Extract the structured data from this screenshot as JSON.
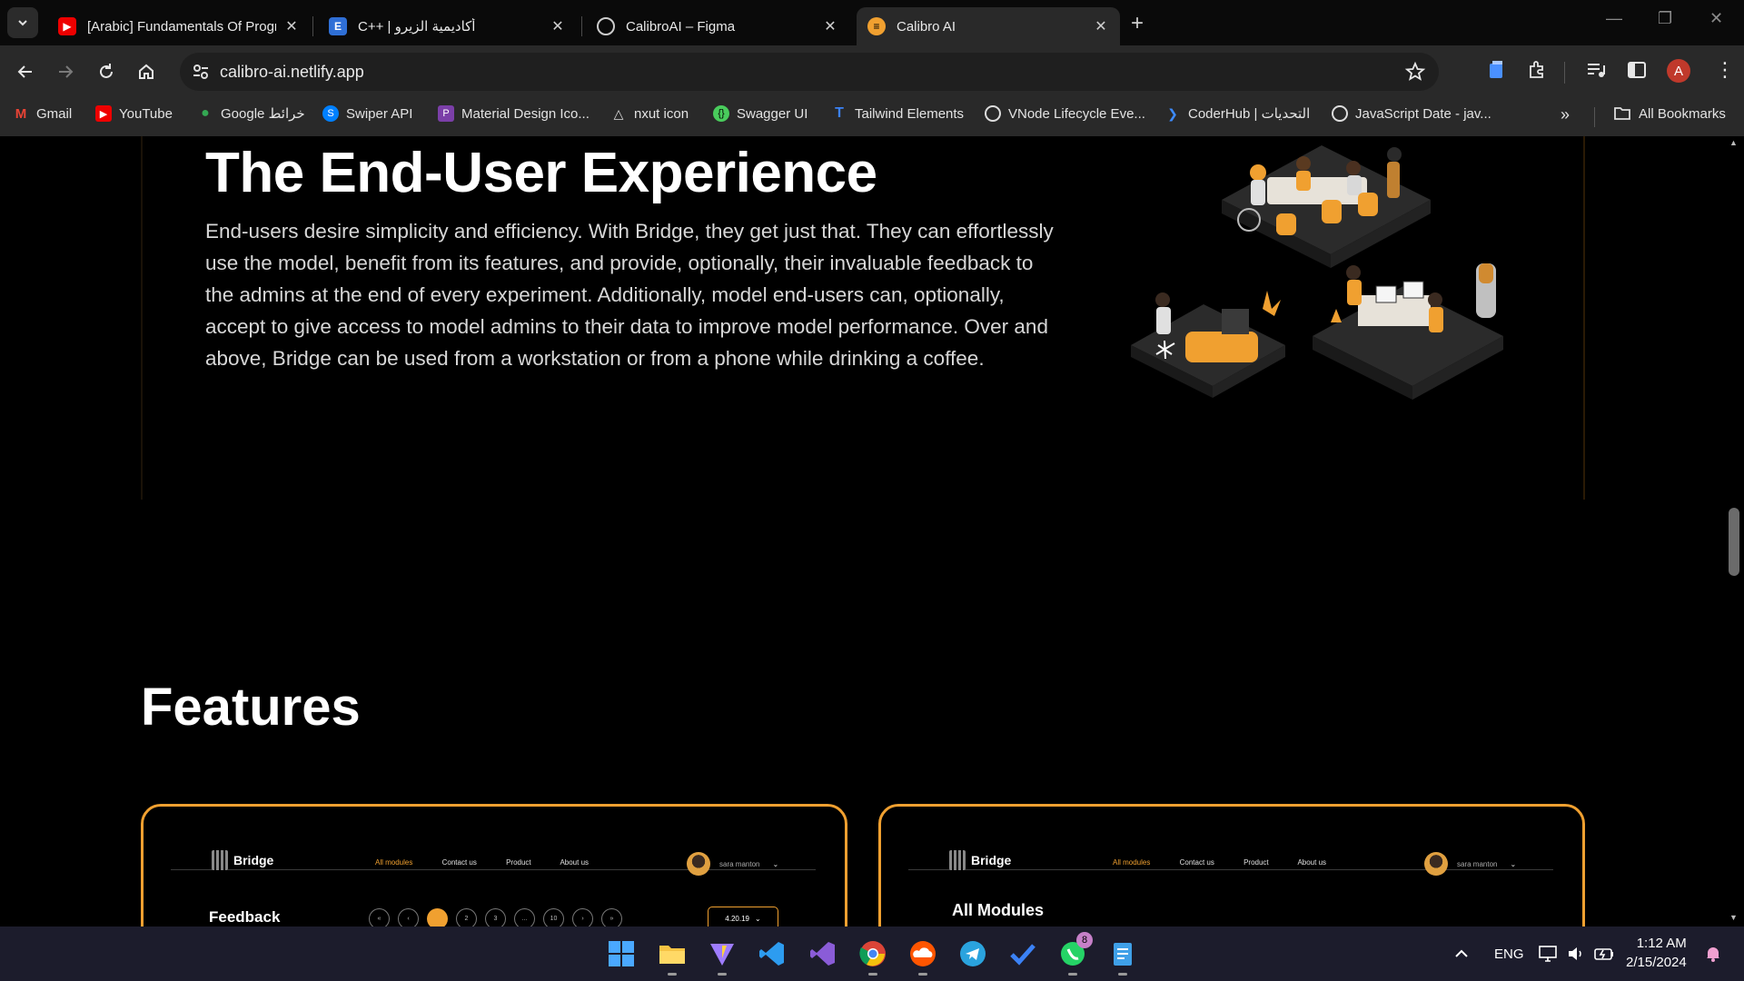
{
  "browser": {
    "tabs": [
      {
        "title": "[Arabic] Fundamentals Of Progr",
        "favicon": "youtube-icon"
      },
      {
        "title": "C++ | أكاديمية الزيرو",
        "favicon": "e-letter-icon"
      },
      {
        "title": "CalibroAI – Figma",
        "favicon": "figma-icon"
      },
      {
        "title": "Calibro AI",
        "favicon": "calibro-icon",
        "active": true
      }
    ],
    "url": "calibro-ai.netlify.app",
    "profile_initial": "A",
    "bookmarks": [
      {
        "label": "Gmail"
      },
      {
        "label": "YouTube"
      },
      {
        "label": "Google خرائط"
      },
      {
        "label": "Swiper API"
      },
      {
        "label": "Material Design Ico..."
      },
      {
        "label": "nxut icon"
      },
      {
        "label": "Swagger UI"
      },
      {
        "label": "Tailwind Elements"
      },
      {
        "label": "VNode Lifecycle Eve..."
      },
      {
        "label": "CoderHub | التحديات"
      },
      {
        "label": "JavaScript Date - jav..."
      }
    ],
    "all_bookmarks": "All Bookmarks"
  },
  "page": {
    "hero_title": "The End-User Experience",
    "hero_text": "End-users desire simplicity and efficiency. With Bridge, they get just that. They can effortlessly use the model, benefit from its features, and provide, optionally, their invaluable feedback to the admins at the end of every experiment. Additionally, model end-users can, optionally, accept to give access to model admins to their data to improve model performance. Over and above, Bridge can be used from a workstation or from a phone while drinking a coffee.",
    "features_title": "Features",
    "feature_cards": [
      {
        "logo": "Bridge",
        "nav": [
          "All modules",
          "Contact us",
          "Product",
          "About us"
        ],
        "user": "sara manton",
        "heading": "Feedback",
        "pager": [
          "«",
          "‹",
          "1",
          "2",
          "3",
          "…",
          "10",
          "›",
          "»"
        ],
        "version": "4.20.19"
      },
      {
        "logo": "Bridge",
        "nav": [
          "All modules",
          "Contact us",
          "Product",
          "About us"
        ],
        "user": "sara manton",
        "heading": "All Modules"
      }
    ]
  },
  "taskbar": {
    "language": "ENG",
    "time": "1:12 AM",
    "date": "2/15/2024",
    "whatsapp_badge": "8"
  },
  "colors": {
    "accent": "#f0a030",
    "page_bg": "#000000",
    "chrome_bg": "#292929"
  }
}
